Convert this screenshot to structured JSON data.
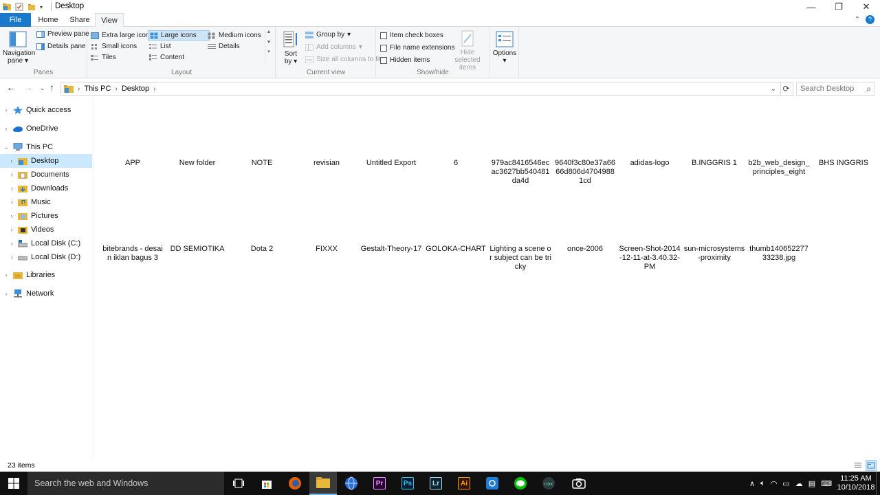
{
  "window": {
    "title": "Desktop",
    "controls": {
      "minimize": "—",
      "maximize": "❐",
      "close": "✕"
    }
  },
  "ribbon_tabs": [
    "File",
    "Home",
    "Share",
    "View"
  ],
  "ribbon_help": {
    "collapse": "⌃",
    "help": "?"
  },
  "panes": {
    "navigation_pane_l1": "Navigation",
    "navigation_pane_l2": "pane",
    "preview_pane": "Preview pane",
    "details_pane": "Details pane",
    "label": "Panes"
  },
  "layout": {
    "extra_large_icons": "Extra large icons",
    "large_icons": "Large icons",
    "medium_icons": "Medium icons",
    "small_icons": "Small icons",
    "list": "List",
    "details": "Details",
    "tiles": "Tiles",
    "content": "Content",
    "label": "Layout"
  },
  "current_view": {
    "sort_by_l1": "Sort",
    "sort_by_l2": "by",
    "group_by": "Group by",
    "add_columns": "Add columns",
    "size_all_columns": "Size all columns to fit",
    "label": "Current view"
  },
  "show_hide": {
    "item_check_boxes": "Item check boxes",
    "file_name_extensions": "File name extensions",
    "hidden_items": "Hidden items",
    "hide_selected_l1": "Hide selected",
    "hide_selected_l2": "items",
    "label": "Show/hide"
  },
  "options": {
    "label": "Options"
  },
  "address": {
    "breadcrumb": [
      "This PC",
      "Desktop"
    ],
    "search_placeholder": "Search Desktop"
  },
  "nav": {
    "quick_access": "Quick access",
    "onedrive": "OneDrive",
    "this_pc": "This PC",
    "desktop": "Desktop",
    "documents": "Documents",
    "downloads": "Downloads",
    "music": "Music",
    "pictures": "Pictures",
    "videos": "Videos",
    "local_c": "Local Disk (C:)",
    "local_d": "Local Disk (D:)",
    "libraries": "Libraries",
    "network": "Network"
  },
  "files": [
    "APP",
    "New folder",
    "NOTE",
    "revisian",
    "Untitled Export",
    "6",
    "979ac8416546ecac3627bb540481da4d",
    "9640f3c80e37a6666d806d47049881cd",
    "adidas-logo",
    "B.INGGRIS 1",
    "b2b_web_design_principles_eight",
    "BHS INGGRIS",
    "bitebrands - desain iklan bagus 3",
    "DD SEMIOTIKA",
    "Dota 2",
    "FIXXX",
    "Gestalt-Theory-17",
    "GOLOKA-CHART",
    "Lighting a scene or subject can be tricky",
    "once-2006",
    "Screen-Shot-2014-12-11-at-3.40.32-PM",
    "sun-microsystems-proximity",
    "thumb14065227733238.jpg"
  ],
  "status": {
    "item_count": "23 items"
  },
  "taskbar": {
    "search_placeholder": "Search the web and Windows",
    "apps": [
      "Pr",
      "Ps",
      "Lr",
      "Ai"
    ],
    "time": "11:25 AM",
    "date": "10/10/2018"
  }
}
